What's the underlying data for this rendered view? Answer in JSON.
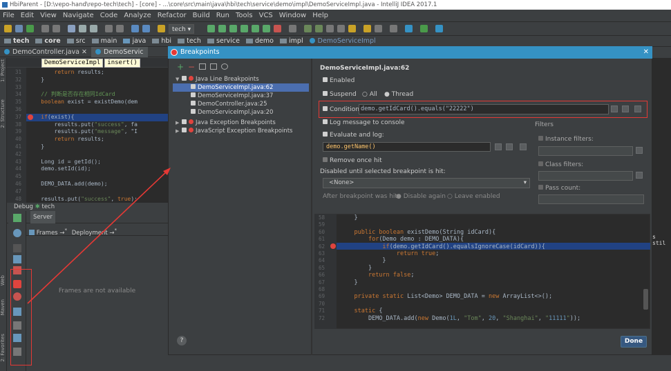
{
  "window": {
    "title": "HbiParent - [D:\\vepo-hand\\repo-tech\\tech] - [core] - ...\\core\\src\\main\\java\\hbi\\tech\\service\\demo\\impl\\DemoServiceImpl.java - IntelliJ IDEA 2017.1"
  },
  "menu": [
    "File",
    "Edit",
    "View",
    "Navigate",
    "Code",
    "Analyze",
    "Refactor",
    "Build",
    "Run",
    "Tools",
    "VCS",
    "Window",
    "Help"
  ],
  "toolbar": {
    "run_config": "tech"
  },
  "nav": {
    "items": [
      "tech",
      "core",
      "src",
      "main",
      "java",
      "hbi",
      "tech",
      "service",
      "demo",
      "impl",
      "DemoServiceImpl"
    ]
  },
  "tabs": [
    "DemoController.java",
    "DemoServic"
  ],
  "editor": {
    "crumb_class": "DemoServiceImpl",
    "crumb_method": "insert()",
    "lines": [
      {
        "n": "31",
        "code": "        return results;"
      },
      {
        "n": "32",
        "code": "    }"
      },
      {
        "n": "33",
        "code": ""
      },
      {
        "n": "34",
        "code": "    // 判断是否存在相同IdCard"
      },
      {
        "n": "35",
        "code": "    boolean exist = existDemo(dem"
      },
      {
        "n": "36",
        "code": ""
      },
      {
        "n": "37",
        "code": "    if(exist){"
      },
      {
        "n": "38",
        "code": "        results.put(\"success\", fa"
      },
      {
        "n": "39",
        "code": "        results.put(\"message\", \"I"
      },
      {
        "n": "40",
        "code": "        return results;"
      },
      {
        "n": "41",
        "code": "    }"
      },
      {
        "n": "42",
        "code": ""
      },
      {
        "n": "43",
        "code": "    Long id = getId();"
      },
      {
        "n": "44",
        "code": "    demo.setId(id);"
      },
      {
        "n": "45",
        "code": ""
      },
      {
        "n": "46",
        "code": "    DEMO_DATA.add(demo);"
      },
      {
        "n": "47",
        "code": ""
      },
      {
        "n": "48",
        "code": "    results.put(\"success\", true);"
      }
    ]
  },
  "side_tools": [
    "1: Project",
    "2: Structure",
    "Web",
    "Maven",
    "2: Favorites"
  ],
  "debug": {
    "header": "Debug",
    "config": "tech",
    "server_tab": "Server",
    "frames_label": "Frames",
    "deployment_label": "Deployment",
    "frames_empty": "Frames are not available"
  },
  "dialog": {
    "title": "Breakpoints",
    "tree": [
      {
        "label": "Java Line Breakpoints",
        "level": 0,
        "expanded": true
      },
      {
        "label": "DemoServiceImpl.java:62",
        "level": 1,
        "selected": true
      },
      {
        "label": "DemoServiceImpl.java:37",
        "level": 1
      },
      {
        "label": "DemoController.java:25",
        "level": 1
      },
      {
        "label": "DemoServiceImpl.java:20",
        "level": 1
      },
      {
        "label": "Java Exception Breakpoints",
        "level": 0
      },
      {
        "label": "JavaScript Exception Breakpoints",
        "level": 0
      }
    ],
    "props": {
      "heading": "DemoServiceImpl.java:62",
      "enabled": "Enabled",
      "suspend": "Suspend",
      "all": "All",
      "thread": "Thread",
      "condition_label": "Condition:",
      "condition": "demo.getIdCard().equals(\"22222\")",
      "log_message": "Log message to console",
      "evaluate_log": "Evaluate and log:",
      "evaluate_value": "demo.getName()",
      "remove_once": "Remove once hit",
      "disabled_until": "Disabled until selected breakpoint is hit:",
      "none_option": "<None>",
      "after_hit": "After breakpoint was hit",
      "disable_again": "Disable again",
      "leave_enabled": "Leave enabled",
      "filters": "Filters",
      "instance_filters": "Instance filters:",
      "class_filters": "Class filters:",
      "pass_count": "Pass count:"
    },
    "code": [
      {
        "n": "58",
        "code": "    }"
      },
      {
        "n": "59",
        "code": ""
      },
      {
        "n": "60",
        "code": "    public boolean existDemo(String idCard){"
      },
      {
        "n": "61",
        "code": "        for(Demo demo : DEMO_DATA){"
      },
      {
        "n": "62",
        "code": "            if(demo.getIdCard().equalsIgnoreCase(idCard)){"
      },
      {
        "n": "63",
        "code": "                return true;"
      },
      {
        "n": "64",
        "code": "            }"
      },
      {
        "n": "65",
        "code": "        }"
      },
      {
        "n": "66",
        "code": "        return false;"
      },
      {
        "n": "67",
        "code": "    }"
      },
      {
        "n": "68",
        "code": ""
      },
      {
        "n": "69",
        "code": "    private static List<Demo> DEMO_DATA = new ArrayList<>();"
      },
      {
        "n": "70",
        "code": ""
      },
      {
        "n": "71",
        "code": "    static {"
      },
      {
        "n": "72",
        "code": "        DEMO_DATA.add(new Demo(1L, \"Tom\", 20, \"Shanghai\", \"11111\"));"
      }
    ],
    "done": "Done",
    "help": "?"
  },
  "right_overflow": "s stil",
  "colors": {
    "accent": "#3592c4",
    "highlight": "#214283",
    "annotation": "#e53935"
  }
}
